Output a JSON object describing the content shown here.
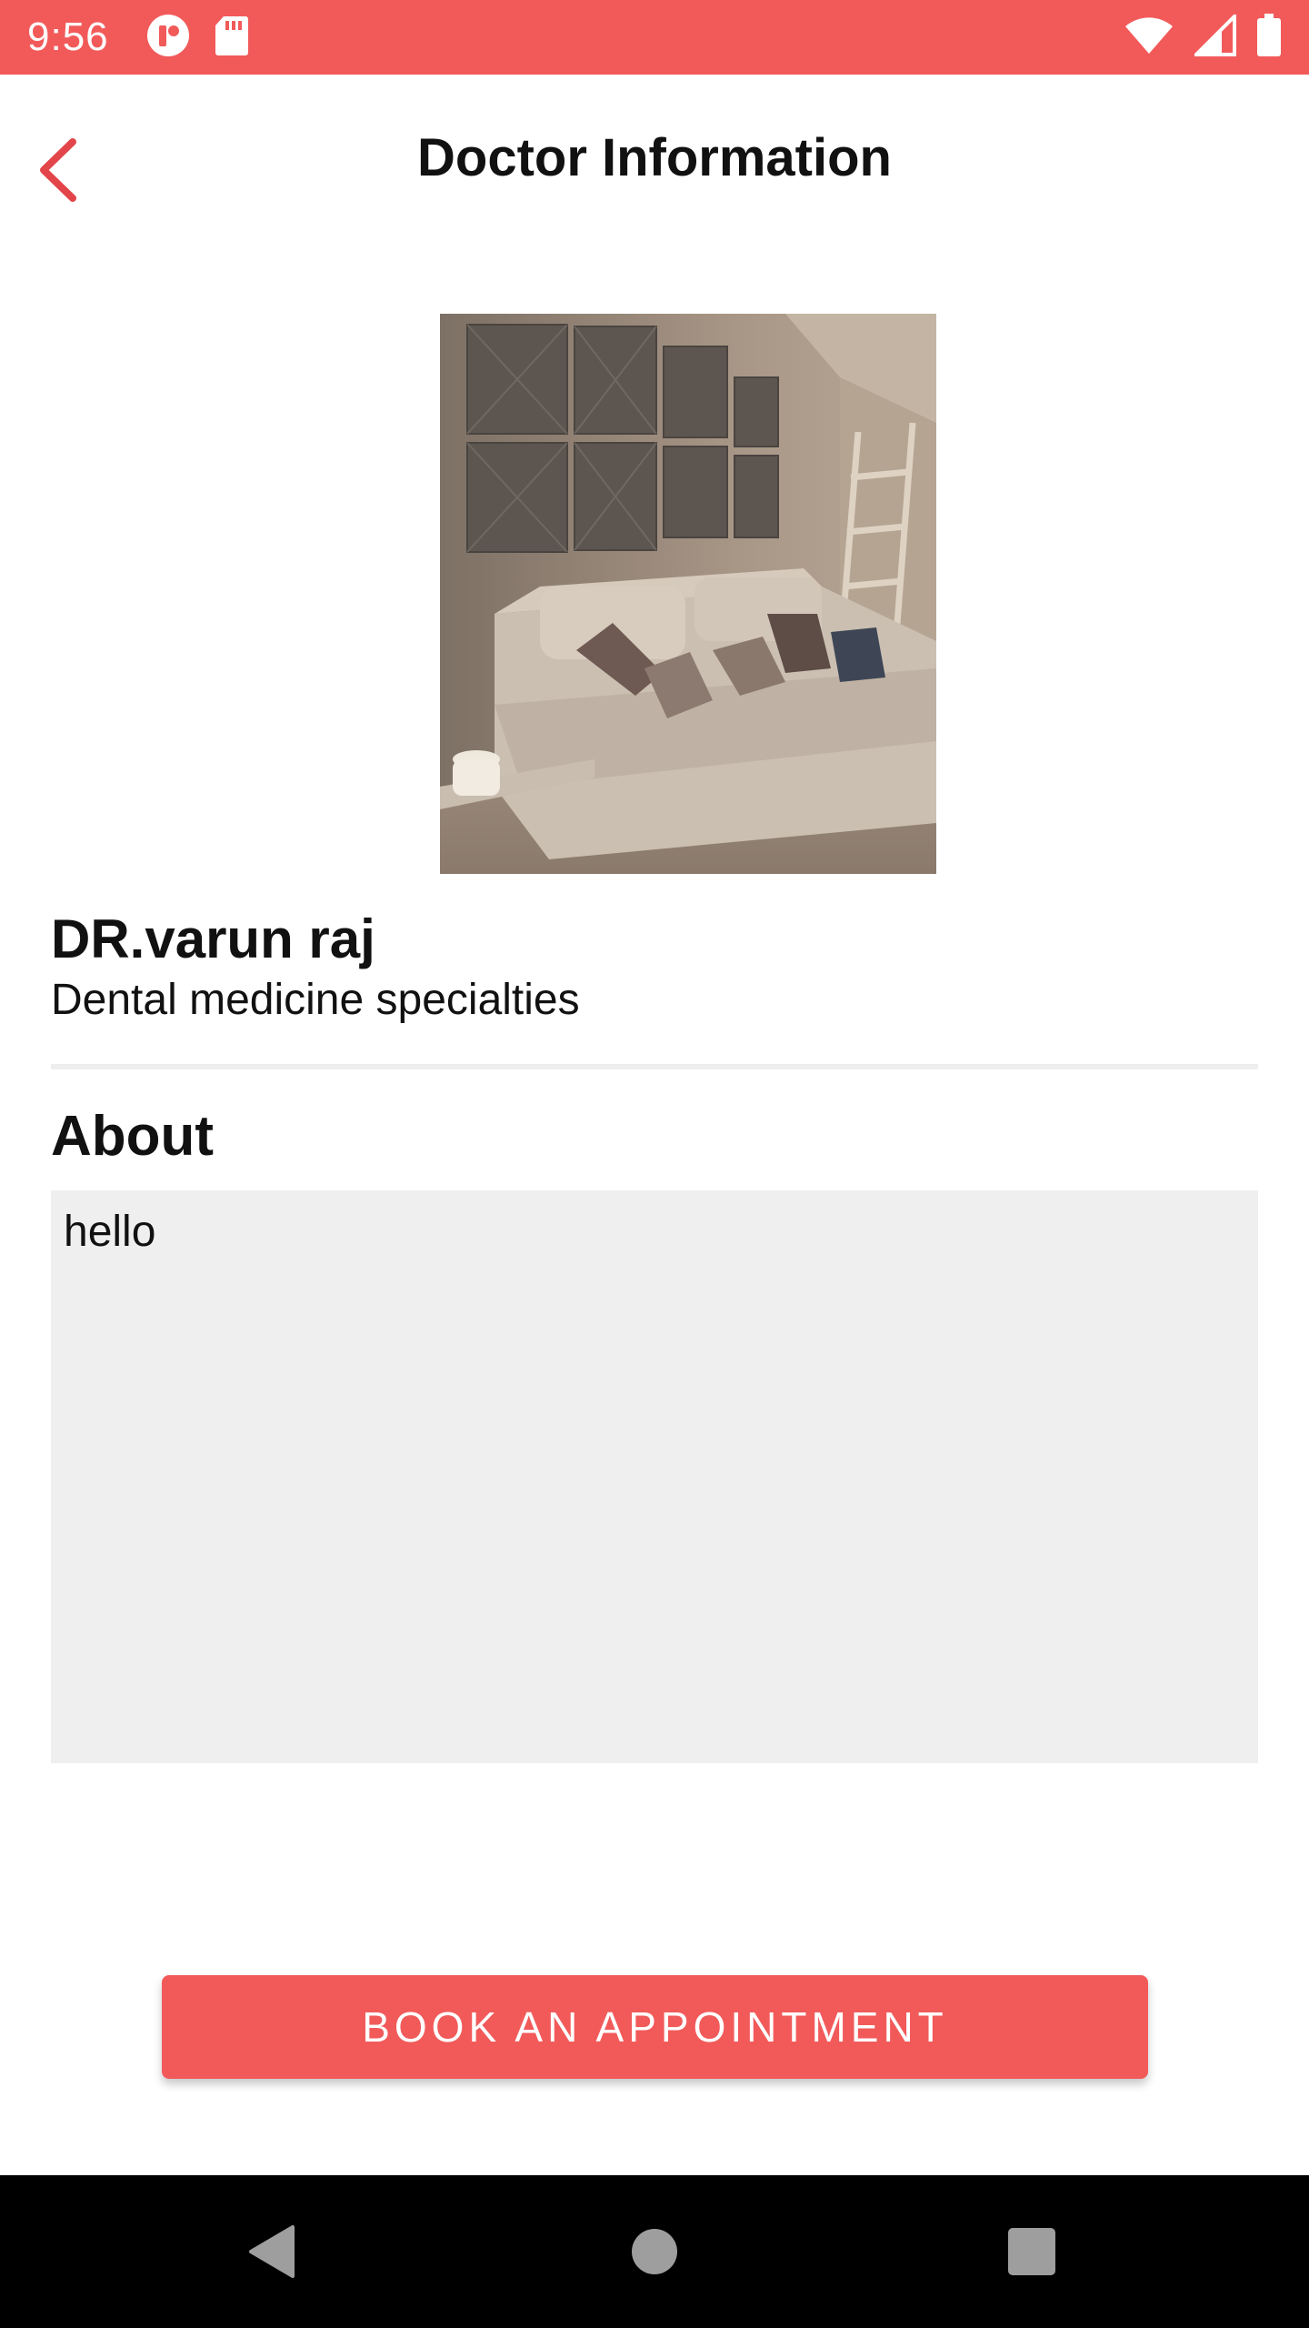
{
  "status_bar": {
    "time": "9:56",
    "left_icons": [
      "app-notification-icon",
      "sd-card-icon"
    ],
    "right_icons": [
      "wifi-icon",
      "cell-signal-icon",
      "battery-icon"
    ],
    "background_color": "#f25a5a"
  },
  "app_bar": {
    "title": "Doctor Information",
    "back_icon": "chevron-left-icon",
    "accent_color": "#e2464a"
  },
  "doctor": {
    "photo_description_icon": "doctor-photo",
    "name": "DR.varun raj",
    "specialty": "Dental medicine specialties"
  },
  "about": {
    "heading": "About",
    "text": "hello"
  },
  "actions": {
    "book_label": "BOOK AN APPOINTMENT",
    "button_color": "#f25a5a"
  },
  "nav_bar": {
    "icons": [
      "back-triangle-icon",
      "home-circle-icon",
      "recents-square-icon"
    ]
  }
}
